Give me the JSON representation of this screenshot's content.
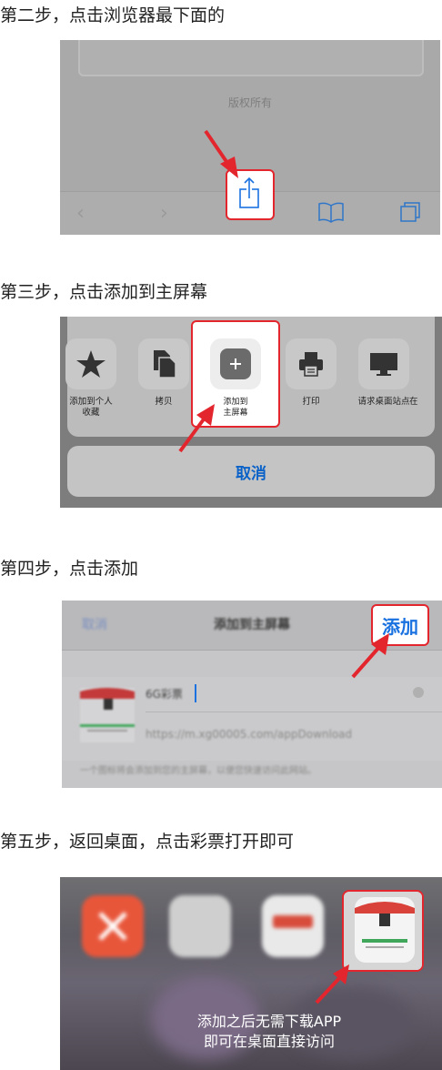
{
  "steps": {
    "step2": {
      "title": "第二步，点击浏览器最下面的",
      "copyright": "版权所有"
    },
    "step3": {
      "title": "第三步，点击添加到主屏幕",
      "actions": [
        {
          "label": "添加到个人\n收藏",
          "icon": "star-icon"
        },
        {
          "label": "拷贝",
          "icon": "copy-icon"
        },
        {
          "label": "添加到\n主屏幕",
          "icon": "plus-icon"
        },
        {
          "label": "打印",
          "icon": "printer-icon"
        },
        {
          "label": "请求桌面站点",
          "icon": "desktop-icon"
        },
        {
          "label": "在",
          "icon": ""
        }
      ],
      "cancel_label": "取消"
    },
    "step4": {
      "title": "第四步，点击添加",
      "nav_cancel": "取消",
      "nav_title": "添加到主屏幕",
      "add_label": "添加",
      "app_name": "6G彩票",
      "url": "https://m.xg00005.com/appDownload",
      "footnote": "一个图标将会添加到您的主屏幕，以便您快速访问此网站。"
    },
    "step5": {
      "title": "第五步，返回桌面，点击彩票打开即可",
      "caption_line1": "添加之后无需下载APP",
      "caption_line2": "即可在桌面直接访问"
    }
  },
  "colors": {
    "highlight": "#e3262d",
    "link_blue": "#1a72e0"
  }
}
